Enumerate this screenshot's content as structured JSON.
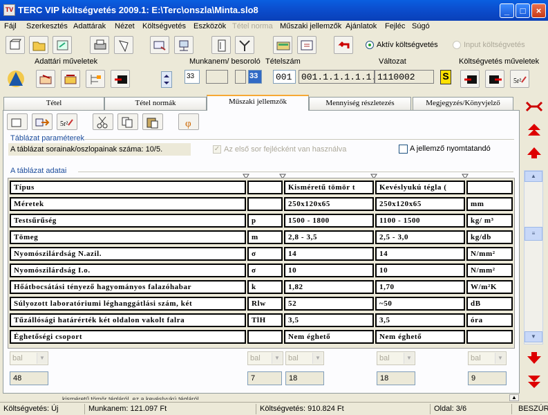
{
  "window": {
    "title": "TERC VIP költségvetés 2009.1:  E:\\Terc\\onszla\\Minta.slo8",
    "icon_text": "TV"
  },
  "menu": [
    "Fájl",
    "Szerkesztés",
    "Adattárak",
    "Nézet",
    "Költségvetés",
    "Eszközök",
    "Tétel norma",
    "Műszaki jellemzők",
    "Ajánlatok",
    "Fejléc",
    "Súgó"
  ],
  "toolbar": {
    "radio_active": "Aktív költségvetés",
    "radio_input": "Input költségvetés"
  },
  "header": {
    "adattari_label": "Adattári műveletek",
    "munkanem_label": "Munkanem/ besoroló",
    "tetelszam_label": "Tételszám",
    "valtozat_label": "Változat",
    "kts_label": "Költségvetés műveletek",
    "munkanem_value": "33",
    "tetelszam_prefix": "33",
    "tetelszam_mid": "001",
    "tetelszam_full": "001.1.1.1.1.1.1",
    "valtozat_value": "1110002",
    "s_badge": "S"
  },
  "tabs": [
    "Tétel",
    "Tétel normák",
    "Műszaki jellemzők",
    "Mennyiség részletezés",
    "Megjegyzés/Könyvjelző"
  ],
  "params": {
    "section_title": "Táblázat paraméterek",
    "size_text": "A táblázat sorainak/oszlopainak száma: 10/5.",
    "first_row_header": "Az első sor fejlécként van használva",
    "printable": "A jellemző nyomtatandó"
  },
  "table": {
    "section_title": "A táblázat adatai",
    "rows": [
      [
        "Típus",
        "",
        "Kisméretű tömör t",
        "Kevéslyukú tégla (",
        ""
      ],
      [
        "Méretek",
        "",
        "250x120x65",
        "250x120x65",
        "mm"
      ],
      [
        "Testsűrűség",
        "p",
        "1500 - 1800",
        "1100 - 1500",
        "kg/ m³"
      ],
      [
        "Tömeg",
        "m",
        "2,8 - 3,5",
        "2,5 - 3,0",
        "kg/db"
      ],
      [
        "Nyomószilárdság N.azil.",
        "σ",
        "14",
        "14",
        "N/mm²"
      ],
      [
        "Nyomószilárdság I.o.",
        "σ",
        "10",
        "10",
        "N/mm²"
      ],
      [
        "Hőátbocsátási tényező hagyományos falazóhabar",
        "k",
        "1,82",
        "1,70",
        "W/m²K"
      ],
      [
        "Súlyozott laboratóriumi léghanggátlási szám, két",
        "Rlw",
        "52",
        "~50",
        "dB"
      ],
      [
        "Tűzállósági határérték két oldalon vakolt falra",
        "TlH",
        "3,5",
        "3,5",
        "óra"
      ],
      [
        "Éghetőségi csoport",
        "",
        "Nem éghető",
        "Nem éghető",
        ""
      ]
    ],
    "align": [
      "bal",
      "bal",
      "bal",
      "bal",
      "bal"
    ],
    "widths": [
      "48",
      "7",
      "18",
      "18",
      "9"
    ]
  },
  "status": {
    "kts": "Költségvetés: Új",
    "munkanem": "Munkanem: 121.097 Ft",
    "koltsegvetes": "Költségvetés: 910.824 Ft",
    "oldal": "Oldal: 3/6",
    "mode": "BESZÚR",
    "bottom_fragment": "kisméretű tömör tégláról, ez a kevéslyukú tégláról"
  }
}
